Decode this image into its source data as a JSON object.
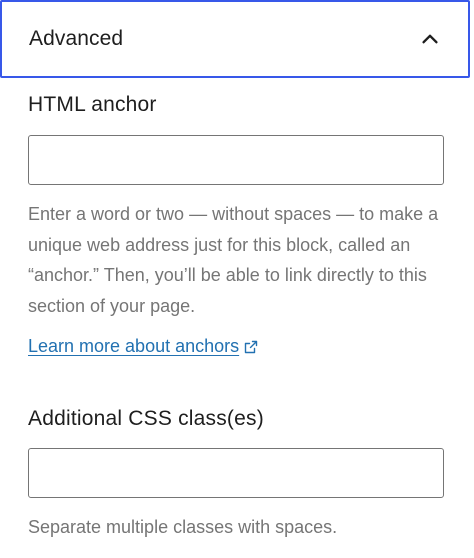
{
  "panel": {
    "title": "Advanced",
    "toggle_icon": "chevron-up-icon"
  },
  "html_anchor": {
    "label": "HTML anchor",
    "value": "",
    "placeholder": "",
    "help": "Enter a word or two — without spaces — to make a unique web address just for this block, called an “anchor.” Then, you’ll be able to link directly to this section of your page.",
    "link_text": "Learn more about anchors",
    "link_icon": "external-link-icon"
  },
  "css_classes": {
    "label": "Additional CSS class(es)",
    "value": "",
    "placeholder": "",
    "help": "Separate multiple classes with spaces."
  },
  "colors": {
    "focus_border": "#3858e9",
    "link": "#2271b1",
    "help_text": "#757575",
    "text": "#1e1e1e"
  }
}
